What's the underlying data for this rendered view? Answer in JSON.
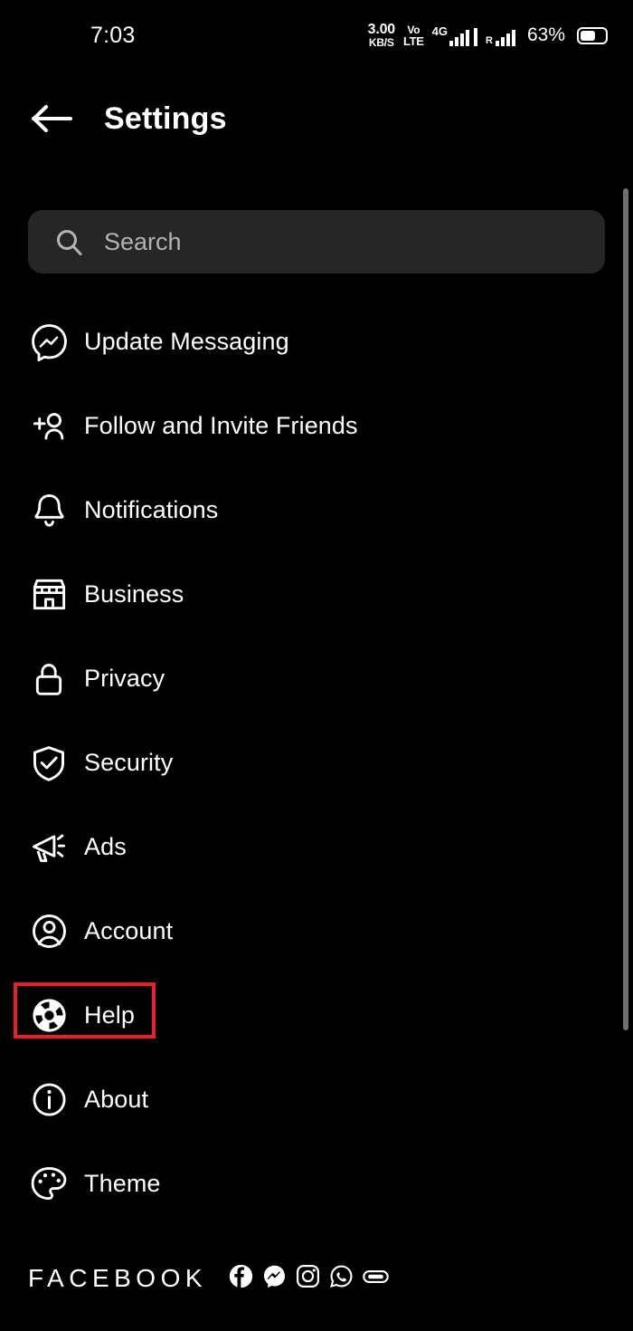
{
  "status_bar": {
    "time": "7:03",
    "network_speed_value": "3.00",
    "network_speed_unit": "KB/S",
    "volte_top": "Vo",
    "volte_bottom": "LTE",
    "network_type": "4G",
    "roaming_label": "R",
    "battery_percent": "63%",
    "icons": [
      "signal-bars-icon",
      "roaming-signal-bars-icon",
      "battery-icon"
    ]
  },
  "header": {
    "back_icon": "arrow-left-icon",
    "title": "Settings"
  },
  "search": {
    "icon": "search-icon",
    "placeholder": "Search",
    "value": ""
  },
  "menu": {
    "items": [
      {
        "label": "Update Messaging",
        "icon": "messenger-icon",
        "highlighted": false
      },
      {
        "label": "Follow and Invite Friends",
        "icon": "person-add-icon",
        "highlighted": false
      },
      {
        "label": "Notifications",
        "icon": "bell-icon",
        "highlighted": false
      },
      {
        "label": "Business",
        "icon": "storefront-icon",
        "highlighted": false
      },
      {
        "label": "Privacy",
        "icon": "lock-icon",
        "highlighted": false
      },
      {
        "label": "Security",
        "icon": "shield-check-icon",
        "highlighted": false
      },
      {
        "label": "Ads",
        "icon": "megaphone-icon",
        "highlighted": false
      },
      {
        "label": "Account",
        "icon": "user-circle-icon",
        "highlighted": false
      },
      {
        "label": "Help",
        "icon": "lifebuoy-icon",
        "highlighted": true
      },
      {
        "label": "About",
        "icon": "info-circle-icon",
        "highlighted": false
      },
      {
        "label": "Theme",
        "icon": "palette-icon",
        "highlighted": false
      }
    ]
  },
  "footer": {
    "wordmark": "FACEBOOK",
    "app_icons": [
      "facebook-icon",
      "messenger-icon",
      "instagram-icon",
      "whatsapp-icon",
      "oculus-icon"
    ]
  },
  "colors": {
    "background": "#000000",
    "search_field": "#262626",
    "text_primary": "#ffffff",
    "text_placeholder": "#b3b3b3",
    "highlight_border": "#e8202a",
    "scrollbar": "#6e6e6e"
  }
}
